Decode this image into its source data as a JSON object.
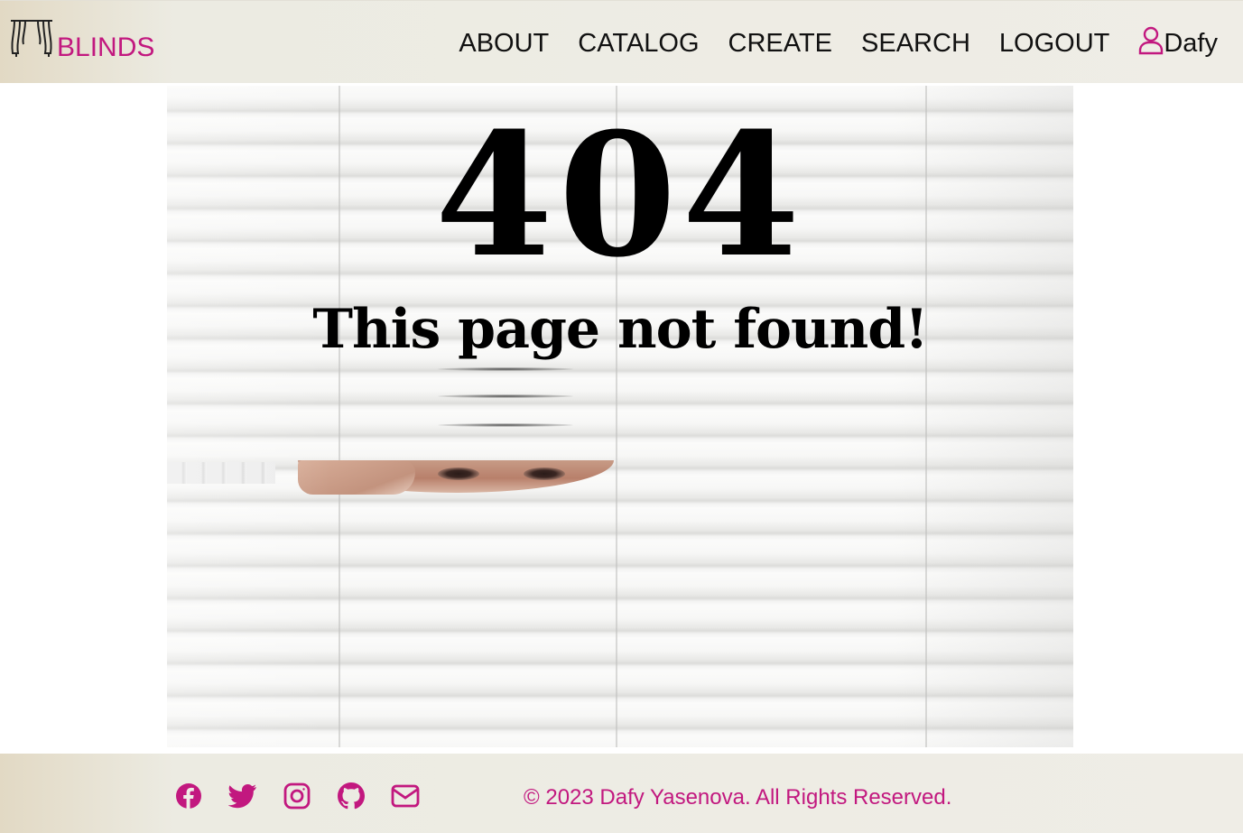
{
  "header": {
    "logo_text": "BLINDS",
    "logo_icon": "curtains-icon",
    "nav": [
      {
        "label": "ABOUT"
      },
      {
        "label": "CATALOG"
      },
      {
        "label": "CREATE"
      },
      {
        "label": "SEARCH"
      },
      {
        "label": "LOGOUT"
      }
    ],
    "user": {
      "icon": "user-icon",
      "name": "Dafy"
    }
  },
  "error": {
    "code": "404",
    "message": "This page not found!"
  },
  "footer": {
    "socials": [
      {
        "icon": "facebook-icon"
      },
      {
        "icon": "twitter-icon"
      },
      {
        "icon": "instagram-icon"
      },
      {
        "icon": "github-icon"
      },
      {
        "icon": "envelope-icon"
      }
    ],
    "copyright": "© 2023 Dafy Yasenova. All Rights Reserved."
  },
  "colors": {
    "accent": "#c2187f",
    "text": "#111111",
    "bar_background": "#efede6"
  }
}
